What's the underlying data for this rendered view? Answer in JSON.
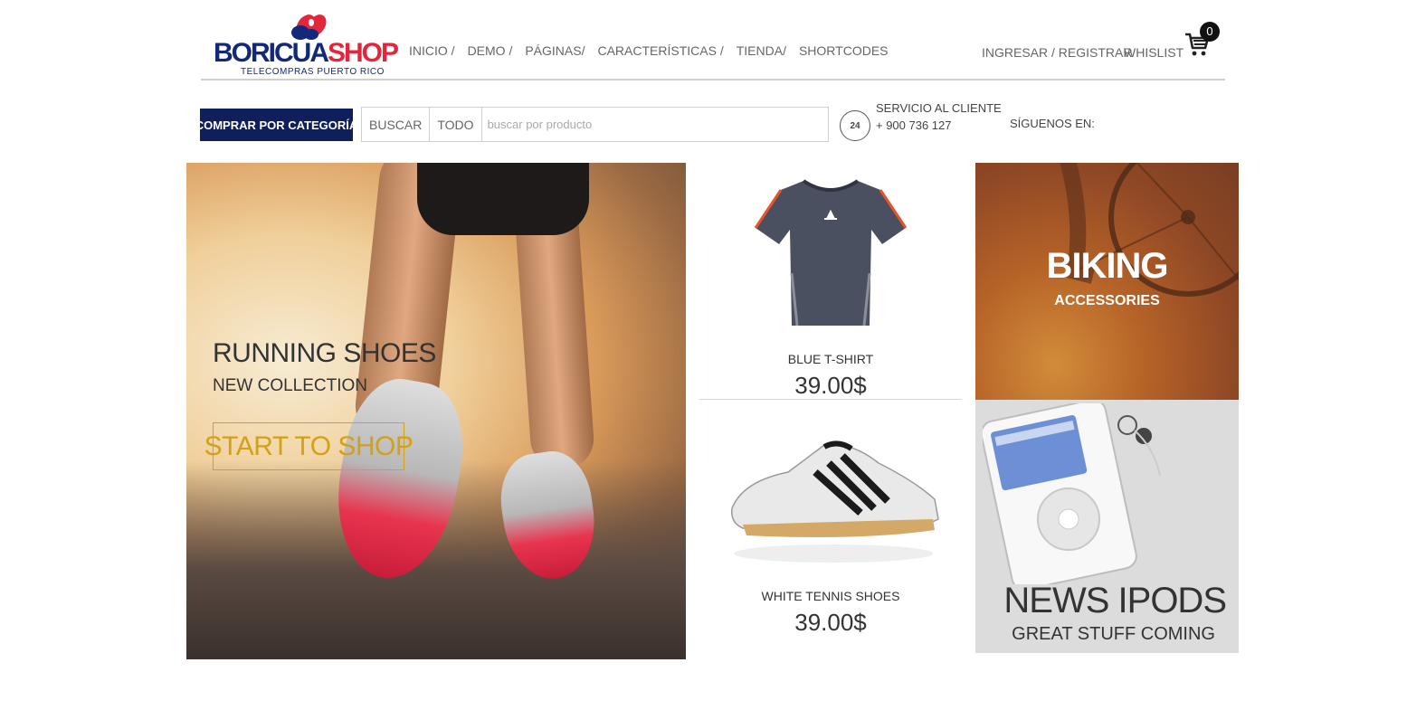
{
  "logo": {
    "part1": "BORICUA",
    "part2": "SHOP",
    "tagline": "TELECOMPRAS PUERTO RICO"
  },
  "nav": {
    "items": [
      "INICIO /",
      "DEMO /",
      "PÁGINAS/",
      "CARACTERÍSTICAS /",
      "TIENDA/",
      "SHORTCODES"
    ]
  },
  "account": {
    "login": "INGRESAR / REGISTRAR",
    "wishlist": "WHISLIST",
    "cart_count": "0"
  },
  "search": {
    "category_button": "COMPRAR POR CATEGORÍA",
    "label": "BUSCAR",
    "scope": "TODO",
    "placeholder": "buscar por producto"
  },
  "service": {
    "label": "SERVICIO AL CLIENTE",
    "phone": "+ 900 736 127",
    "icon_text": "24",
    "follow": "SÍGUENOS EN:"
  },
  "hero": {
    "title": "RUNNING SHOES",
    "subtitle": "NEW COLLECTION",
    "button": "START TO SHOP"
  },
  "products": [
    {
      "name": "BLUE T-SHIRT",
      "price": "39.00$"
    },
    {
      "name": "WHITE TENNIS SHOES",
      "price": "39.00$"
    }
  ],
  "banners": {
    "biking": {
      "title": "BIKING",
      "subtitle": "ACCESSORIES"
    },
    "ipods": {
      "title": "NEWS IPODS",
      "subtitle": "GREAT STUFF COMING"
    }
  },
  "colors": {
    "brand_navy": "#0f1f5c",
    "brand_red": "#e3263b",
    "accent_gold": "#d4a017"
  }
}
